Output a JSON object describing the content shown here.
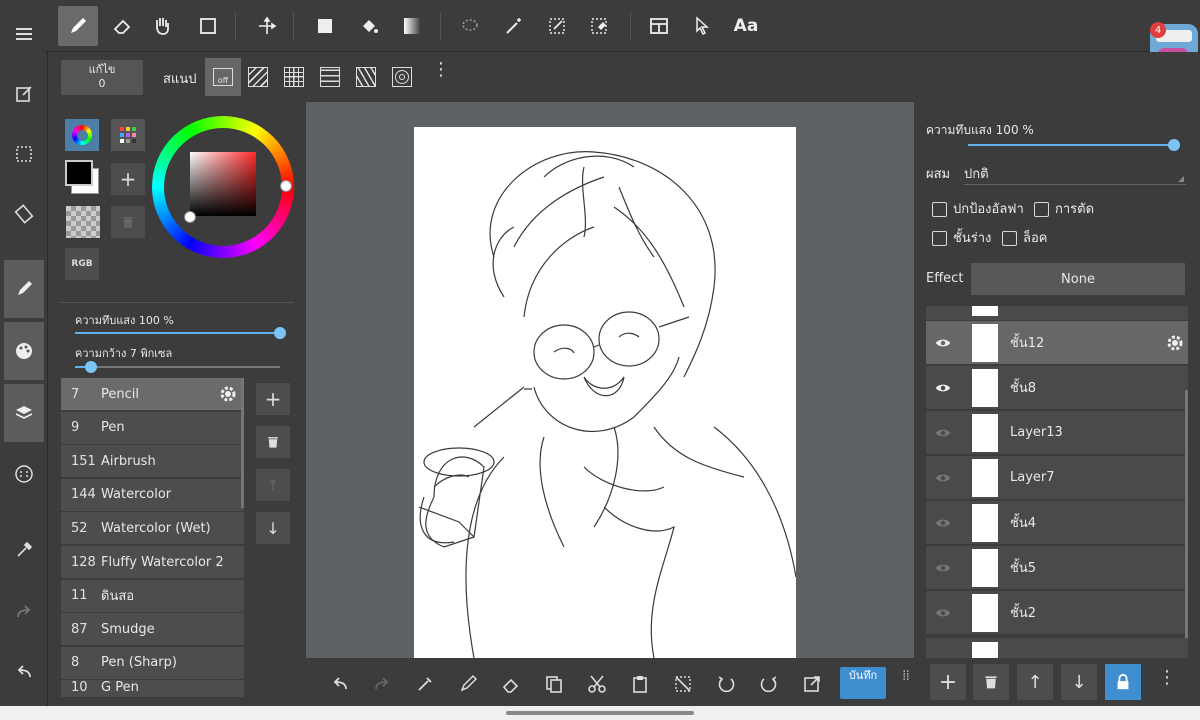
{
  "toolbar": {
    "tools": [
      "pen-icon",
      "eraser-icon",
      "hand-icon",
      "rectangle-icon",
      "move-icon",
      "fill-rect-icon",
      "bucket-icon",
      "gradient-icon",
      "lasso-icon",
      "magic-wand-icon",
      "select-pen-icon",
      "select-eraser-icon",
      "frame-icon",
      "pointer-icon",
      "text-icon"
    ],
    "text_tool_label": "Aa"
  },
  "subbar": {
    "edit_label": "แก้ไข",
    "edit_count": "0",
    "snap_label": "สแนป",
    "snap_off_label": "off"
  },
  "color_panel": {
    "rgb_label": "RGB",
    "primary_color": "#000000",
    "hue_color": "#ff2a2a"
  },
  "brush_settings": {
    "opacity_label": "ความทึบแสง 100 %",
    "opacity_value": 1.0,
    "width_label": "ความกว้าง 7 พิกเซล",
    "width_value": 0.08
  },
  "brushes": [
    {
      "num": "7",
      "name": "Pencil",
      "selected": true
    },
    {
      "num": "9",
      "name": "Pen"
    },
    {
      "num": "151",
      "name": "Airbrush"
    },
    {
      "num": "144",
      "name": "Watercolor"
    },
    {
      "num": "52",
      "name": "Watercolor (Wet)"
    },
    {
      "num": "128",
      "name": "Fluffy Watercolor 2"
    },
    {
      "num": "11",
      "name": "ดินสอ"
    },
    {
      "num": "87",
      "name": "Smudge"
    },
    {
      "num": "8",
      "name": "Pen (Sharp)"
    },
    {
      "num": "10",
      "name": "G Pen"
    }
  ],
  "layer_panel": {
    "opacity_label": "ความทึบแสง 100 %",
    "opacity_value": 1.0,
    "blend_label": "ผสม",
    "blend_value": "ปกติ",
    "protect_alpha": "ปกป้องอัลฟา",
    "clipping": "การตัด",
    "draft": "ชั้นร่าง",
    "lock": "ล็อค",
    "effect_label": "Effect",
    "effect_value": "None",
    "layers": [
      {
        "name": "ชั้น12",
        "visible": true,
        "selected": true
      },
      {
        "name": "ชั้น8",
        "visible": true
      },
      {
        "name": "Layer13",
        "visible": false
      },
      {
        "name": "Layer7",
        "visible": false
      },
      {
        "name": "ชั้น4",
        "visible": false
      },
      {
        "name": "ชั้น5",
        "visible": false
      },
      {
        "name": "ชั้น2",
        "visible": false
      }
    ]
  },
  "bottombar": {
    "save_label": "บันทึก",
    "accent": "#3f8fd0"
  },
  "notification_count": "4"
}
